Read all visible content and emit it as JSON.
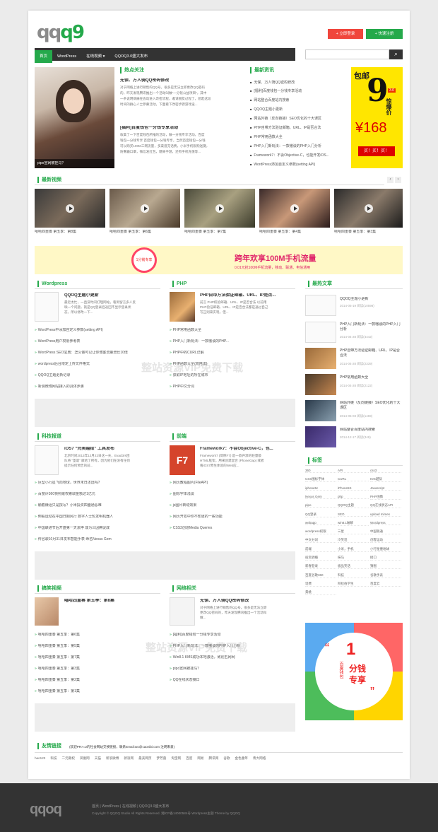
{
  "header": {
    "logo_left": "qq",
    "logo_right": "q9",
    "login": "+ 立即登录",
    "register": "+ 快速注册"
  },
  "nav": {
    "items": [
      "首页",
      "WordPress",
      "在线视频 ▾",
      "QQOQ3.0盛大发布"
    ],
    "search_placeholder": ""
  },
  "hot": {
    "title": "热点关注",
    "caption": "pipo宣网被挂马？",
    "a1_title": "无保、万人骑QQ密码修改",
    "a1_desc": [
      "对于网络上进行销售的QQ号，很多是无法立即更改QQ密码",
      "的，昨天发现腾讯推出一个活动叫做“一分钱公益项目”，其中",
      "一条说明病痛在会动进入改密流程，邀请朋友过程了，想起这段",
      "时间的群心人士参募活动，下面看下改密步骤游戏设..."
    ],
    "a2_title": "[福利]百度钱包一分钱专享活动",
    "a2_desc": [
      "收集了一下百度钱包所推的活动，做一分钱专享活动，百度",
      "钱包一分钱专享 百度钱包一分钱专享，当然百度钱包一分钱",
      "可以购买100M三网流量，多渠道充话费，小米手机限购送键，",
      "防雾霾口罩，微信发红包，糖果手游，还有手机充值等..."
    ]
  },
  "news": {
    "title": "最新资讯",
    "items": [
      "无保、万人骑QQ密码修改",
      "[福利]百度钱包一分钱专享活动",
      "网站整合百度站内搜索",
      "QQOQ主题小更新",
      "网站外链（反向链接）SEO优化的十大误区",
      "PHP自带方法验证邮箱、URL、IP是否合法",
      "PHP常用函数大全",
      "PHP入门新玩法：一款嗷谈的PHP入门分析",
      "Framework7：不会Objective-C，也能开发iOS...",
      "WordPress添加自定义参数(setting API)"
    ]
  },
  "ad": {
    "top": "包邮",
    "num": "9",
    "v": "3.0",
    "side": "惊爆价",
    "price": "¥168",
    "buy": "买！买！买！"
  },
  "videos": {
    "title": "最新视频",
    "items": [
      "嘻哈四重奏 第五季：第8集",
      "嘻哈四重奏 第五季：第6集",
      "嘻哈四重奏 第五季：第7集",
      "嘻哈四重奏 第五季：第5集",
      "嘻哈四重奏 第五季：第4集",
      "嘻哈四重奏 第五季：第3集"
    ]
  },
  "banner": {
    "title": "跨年欢享100M手机流量",
    "sub": "0.01元抢100M手机流量，移动、联通、电信通用",
    "badge": "1分钱专享"
  },
  "wp": {
    "title": "Wordpress",
    "feat_title": "QQOQ主题小更新",
    "feat_desc": [
      "最近太忙，一直没时间打理网站，看到留言多人反",
      "映一个问题，就是QQ登录后返回不显示登录状",
      "态，所以修改一下..."
    ],
    "items": [
      "WordPress中添加自定义参数(setting API)",
      "WordPress用户权限参考表",
      "WordPress SEO宝典：怎么做可以让你博客流量增长10倍",
      "wordpress后台限定上传文件格式",
      "QQOQ主题更新记录",
      "新浪微博网站接入的具体步骤"
    ]
  },
  "php": {
    "title": "PHP",
    "feat_title": "PHP自带方法验证邮箱、URL、IP是否...",
    "feat_desc": [
      "前言 PHP校验邮箱、URL、IP是否合法 以前用",
      "PHP验证邮箱、URL、IP是否合法都是通过自己",
      "写正则来实现，但..."
    ],
    "items": [
      "PHP常用函数大全",
      "PHP入门新玩法：一款嗷谈的PHP...",
      "PHP中的CURL详解",
      "PHP函数大全(附用法)",
      "获取IP地址的所在城市",
      "PHP中文分词"
    ]
  },
  "tech": {
    "title": "科技报道",
    "feat_title": "iOS7 “完美越狱” 工具发布",
    "feat_desc": [
      "北京时间2013年12月22日这一天，Evad3rs团",
      "队将 “圣诞” 献给了所有，因为他们在没有任何",
      "提示任何预告的前..."
    ],
    "items": [
      "巨型小行星飞向地球，世界末日还远吗？",
      "百度评360快照嵌权索取金额达1亿元",
      "躺着赚话只是撰写？小米投资四面通恶难",
      "倒看运动在中国日期风行 数字人士轮发明机器人",
      "中国联通节后开盘第一天涨停 成为三因腾促成",
      "传谷歌10月31日发布智能手表 命名Nexus Gem"
    ]
  },
  "front": {
    "title": "前端",
    "feat_title": "Framework7：不会Objective-C，也...",
    "feat_desc": [
      "Framework7 (简称F7) 是一款开源的轻量级",
      "HTML框架，用来创建混合 (PhoneGap) 或者",
      "看iOS7原生体验的Web应..."
    ],
    "items": [
      "网页教程图片(FileAPI)",
      "图标字体浅谈",
      "js图片转动效果",
      "网页开发中你不知道的一些功能",
      "CSS3创造Media Queries"
    ]
  },
  "funny": {
    "title": "搞笑视频",
    "feat_title": "嘻哈四重奏 第五季：第8集",
    "items": [
      "嘻哈四重奏 第五季：第6集",
      "嘻哈四重奏 第五季：第5集",
      "嘻哈四重奏 第五季：第7集",
      "嘻哈四重奏 第五季：第3集",
      "嘻哈四重奏 第五季：第2集",
      "嘻哈四重奏 第五季：第1集"
    ]
  },
  "net": {
    "title": "网络相关",
    "feat_title": "无保、万人骑QQ密码修改",
    "feat_desc": [
      "对于网络上进行销售的QQ号，很多是无法立即",
      "更改QQ密码的，昨天发现腾讯推出一个活动叫",
      "做..."
    ],
    "items": [
      "[福利]百度钱包一分钱专享活动",
      "PHP入门新玩法：一款嗷谈的PHP入门分析",
      "Win8.1 KMS成功本地激活，致别五网网",
      "pipo宣网被挂马？",
      "QQ在线状态接口"
    ]
  },
  "popular": {
    "title": "最热文章",
    "items": [
      {
        "t": "QQOQ主题小更新",
        "d": "2014-05-19   阅读(10598)"
      },
      {
        "t": "PHP入门新玩法：一款嗷谈的PHP入门分析",
        "d": "2014-04-28   阅读(4442)"
      },
      {
        "t": "PHP自带方法验证邮箱、URL、IP是否合法",
        "d": "2014-04-28   阅读(2339)"
      },
      {
        "t": "PHP常用函数大全",
        "d": "2014-04-28   阅读(2122)"
      },
      {
        "t": "网站外链（反向链接）SEO优化的十大误区",
        "d": "2014-05-03   阅读(1469)"
      },
      {
        "t": "网站整合百度站内搜索",
        "d": "2014-12-17   阅读(349)"
      }
    ]
  },
  "tags": {
    "title": "标签",
    "items": [
      "360",
      "API",
      "css3",
      "CSS图标字体",
      "CURL",
      "IOS越狱",
      "iphone5c",
      "iPhone5S",
      "Javascript",
      "Nexus Gem",
      "php",
      "PHP函数",
      "pipo",
      "QQOQ主题",
      "QQ在线状态API",
      "QQ登录",
      "SEO",
      "upload mimes",
      "webapp",
      "win8.1破解",
      "Wordpress",
      "wordpress权限",
      "三星",
      "中国联通",
      "中文分词",
      "冷笑话",
      "创客运动",
      "前端",
      "小米，手机",
      "小行星撞地球",
      "投资调播",
      "抹马",
      "接口",
      "新春登录",
      "极品笑话",
      "猜图",
      "百度谷歌360",
      "科技",
      "谷歌手表",
      "话费",
      "阿拉伯学生",
      "百度云",
      "黄桃"
    ]
  },
  "sidead": {
    "quote": "“",
    "big": "1",
    "line1": "分钱",
    "line2": "专享",
    "sub": "百度钱包",
    "end": "”"
  },
  "links": {
    "title": "友情链接",
    "note": "(欢迎PR>=2的社会网站交换链接，联系Email:wo@caonibi.com 注明来意)",
    "items": [
      "hao123",
      "科技",
      "二元期权",
      "凤凰网",
      "天猫",
      "新浪微博",
      "新浪网",
      "最美网页",
      "梦芳菌",
      "淘宝网",
      "百度",
      "网易",
      "腾讯网",
      "谷歌",
      "金色童年",
      "青大网络"
    ]
  },
  "footer": {
    "logo": "qqoq",
    "nav": [
      "首页",
      "WordPress",
      "在线视频",
      "QQOQ3.0盛大发布"
    ],
    "copy": "Copyright © QQOQ Studio All Rights Reserved. 湘ICP备14000584号 Wordpress主题 Theme by QQOQ"
  },
  "watermark": "整站资源VIP免费下载"
}
